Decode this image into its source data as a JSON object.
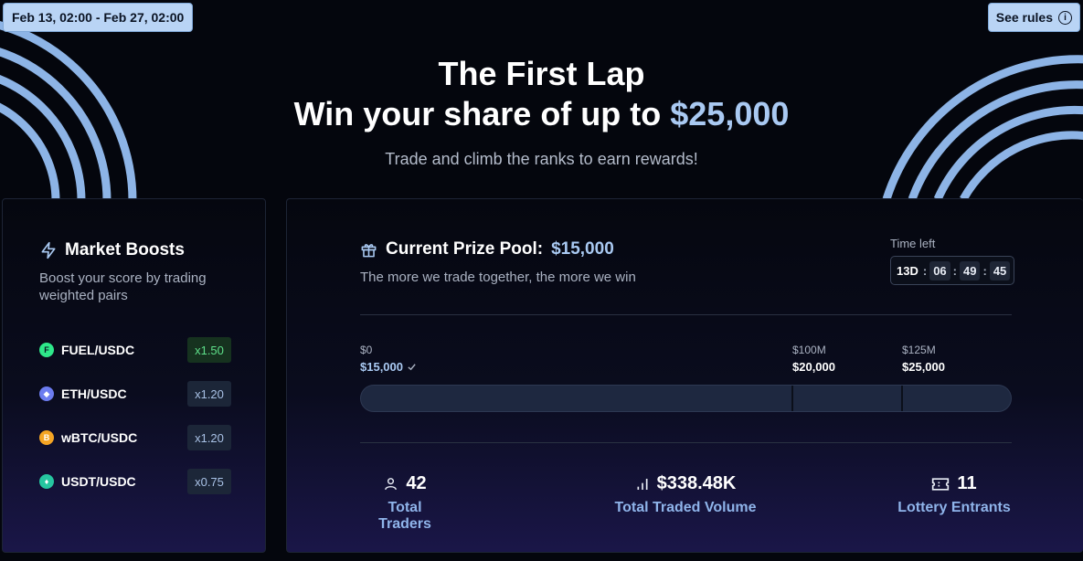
{
  "header": {
    "date_range": "Feb 13, 02:00 - Feb 27, 02:00",
    "rules_label": "See rules"
  },
  "hero": {
    "title": "The First Lap",
    "subtitle_prefix": "Win your share of up to ",
    "subtitle_amount": "$25,000",
    "tagline": "Trade and climb the ranks to earn rewards!"
  },
  "boosts": {
    "title": "Market Boosts",
    "description": "Boost your score by trading weighted pairs",
    "pairs": [
      {
        "name": "FUEL/USDC",
        "multiplier": "x1.50",
        "icon": "fuel-icon",
        "color": "#2ee88a"
      },
      {
        "name": "ETH/USDC",
        "multiplier": "x1.20",
        "icon": "eth-icon",
        "color": "#6c7cf0"
      },
      {
        "name": "wBTC/USDC",
        "multiplier": "x1.20",
        "icon": "btc-icon",
        "color": "#f5a524"
      },
      {
        "name": "USDT/USDC",
        "multiplier": "x0.75",
        "icon": "usdt-icon",
        "color": "#26c6a0"
      }
    ]
  },
  "prize": {
    "title_prefix": "Current Prize Pool: ",
    "title_amount": "$15,000",
    "description": "The more we trade together, the more we win",
    "time_left_label": "Time left",
    "timer": {
      "days": "13D",
      "hours": "06",
      "minutes": "49",
      "seconds": "45"
    },
    "milestones": [
      {
        "volume": "$0",
        "reward": "$15,000",
        "reached": true
      },
      {
        "volume": "$100M",
        "reward": "$20,000",
        "reached": false
      },
      {
        "volume": "$125M",
        "reward": "$25,000",
        "reached": false
      }
    ]
  },
  "stats": {
    "traders": {
      "value": "42",
      "label": "Total Traders"
    },
    "volume": {
      "value": "$338.48K",
      "label": "Total Traded Volume"
    },
    "lottery": {
      "value": "11",
      "label": "Lottery Entrants"
    }
  },
  "colors": {
    "accent": "#a9c9f2",
    "boost_green": "#5fe08a",
    "stat_label": "#8fb4ea"
  }
}
